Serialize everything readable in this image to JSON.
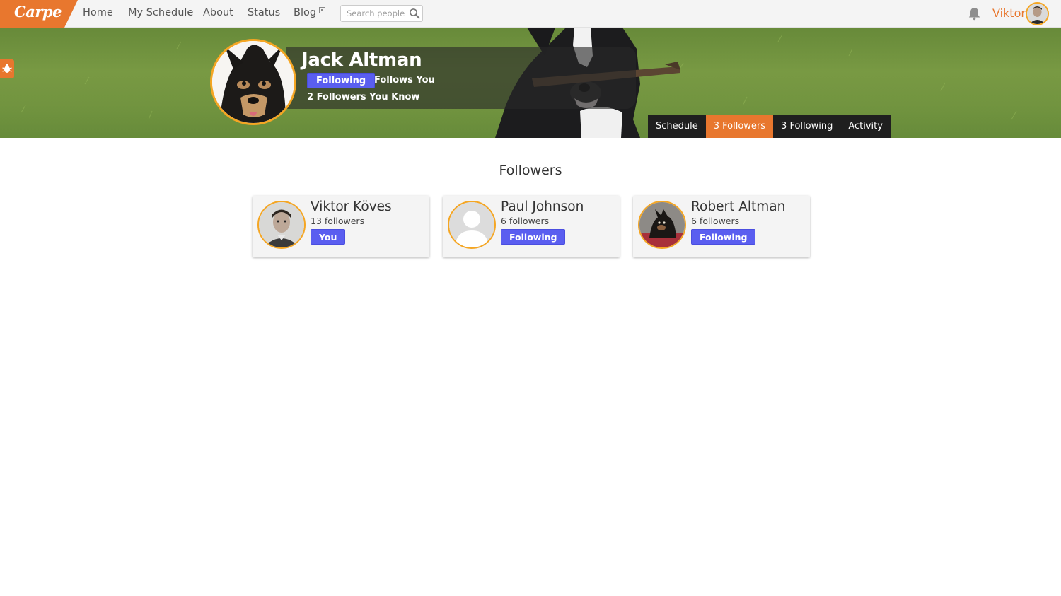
{
  "nav": {
    "logo": "Carpe",
    "links": [
      "Home",
      "My Schedule",
      "About",
      "Status",
      "Blog"
    ],
    "search_placeholder": "Search people",
    "user_name": "Viktor"
  },
  "profile": {
    "name": "Jack Altman",
    "following_label": "Following",
    "follows_you_label": "Follows You",
    "mutual_label": "2 Followers You Know",
    "tabs": [
      "Schedule",
      "3 Followers",
      "3 Following",
      "Activity"
    ],
    "active_tab": "3 Followers"
  },
  "section": {
    "title": "Followers"
  },
  "followers": [
    {
      "name": "Viktor Köves",
      "count": "13 followers",
      "badge": "You"
    },
    {
      "name": "Paul Johnson",
      "count": "6 followers",
      "badge": "Following"
    },
    {
      "name": "Robert Altman",
      "count": "6 followers",
      "badge": "Following"
    }
  ],
  "colors": {
    "accent": "#e8772e",
    "button": "#5a5ef0",
    "avatar_ring": "#f5a623",
    "nav_bg": "#f4f4f4",
    "tab_bg": "#1f1f1f"
  }
}
